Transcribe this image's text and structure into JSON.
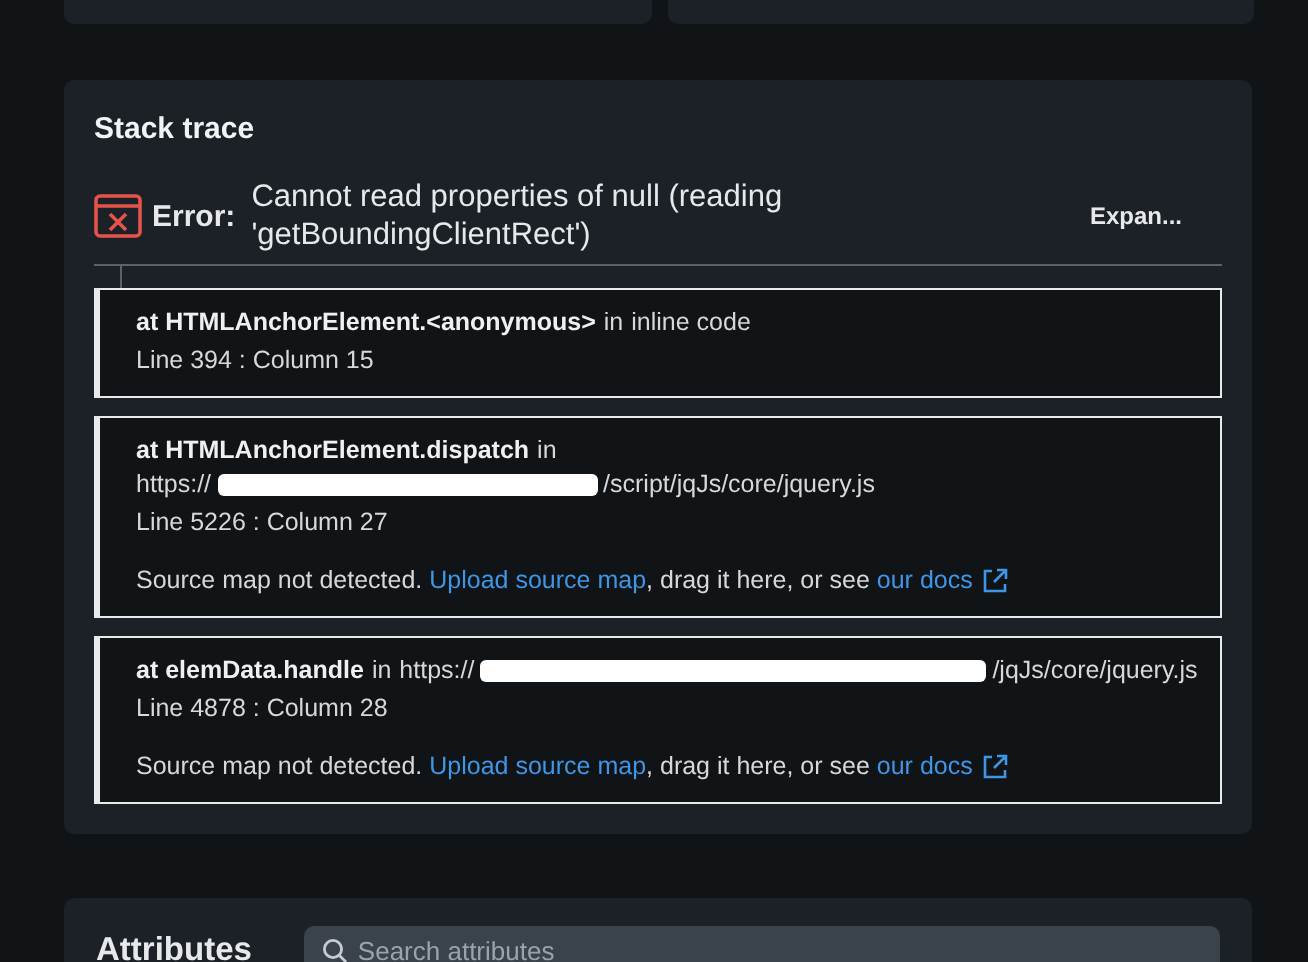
{
  "stack_trace": {
    "title": "Stack trace",
    "error_label": "Error:",
    "error_message": "Cannot read properties of null (reading 'getBoundingClientRect')",
    "expand_button": "Expan...",
    "frames": [
      {
        "function": "at HTMLAnchorElement.<anonymous>",
        "location_prefix": "in",
        "location_start": "inline code",
        "redacted": false,
        "position": "Line 394 : Column 15"
      },
      {
        "function": "at HTMLAnchorElement.dispatch",
        "location_prefix": "in",
        "location_start": "https://",
        "redacted": true,
        "location_end": "/script/jqJs/core/jquery.js",
        "position": "Line 5226 : Column 27",
        "source_map": {
          "before": "Source map not detected.",
          "upload_link": "Upload source map",
          "middle": ", drag it here, or see",
          "docs_link": "our docs"
        }
      },
      {
        "function": "at elemData.handle",
        "location_prefix": "in",
        "location_start": "https://",
        "redacted": true,
        "location_end": "/jqJs/core/jquery.js",
        "position": "Line 4878 : Column 28",
        "source_map": {
          "before": "Source map not detected.",
          "upload_link": "Upload source map",
          "middle": ", drag it here, or see",
          "docs_link": "our docs"
        }
      }
    ]
  },
  "attributes": {
    "title": "Attributes",
    "search": {
      "placeholder": "Search attributes"
    }
  }
}
